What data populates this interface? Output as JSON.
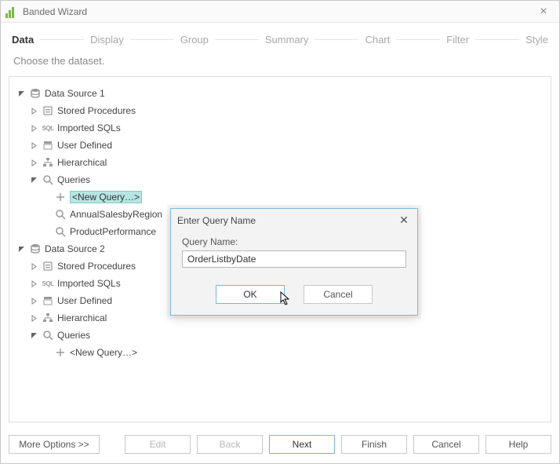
{
  "window": {
    "title": "Banded Wizard"
  },
  "steps": {
    "data": "Data",
    "display": "Display",
    "group": "Group",
    "summary": "Summary",
    "chart": "Chart",
    "filter": "Filter",
    "style": "Style"
  },
  "subtitle": "Choose the dataset.",
  "tree": {
    "ds1": {
      "label": "Data Source 1",
      "stored": "Stored Procedures",
      "imported": "Imported SQLs",
      "user": "User Defined",
      "hier": "Hierarchical",
      "queries": "Queries",
      "newquery": "<New Query…>",
      "q1": "AnnualSalesbyRegion",
      "q2": "ProductPerformance"
    },
    "ds2": {
      "label": "Data Source 2",
      "stored": "Stored Procedures",
      "imported": "Imported SQLs",
      "user": "User Defined",
      "hier": "Hierarchical",
      "queries": "Queries",
      "newquery": "<New Query…>"
    }
  },
  "dialog": {
    "title": "Enter Query Name",
    "label": "Query Name:",
    "value": "OrderListbyDate",
    "ok": "OK",
    "cancel": "Cancel"
  },
  "footer": {
    "more": "More Options >>",
    "edit": "Edit",
    "back": "Back",
    "next": "Next",
    "finish": "Finish",
    "cancel": "Cancel",
    "help": "Help"
  }
}
